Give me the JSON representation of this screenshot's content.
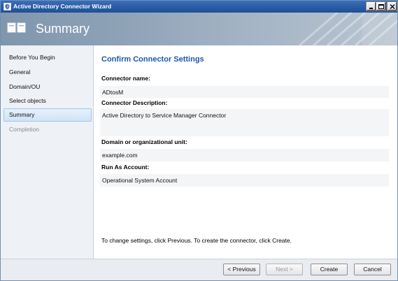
{
  "window": {
    "title": "Active Directory Connector Wizard",
    "app_icon": "shield-icon",
    "controls": [
      "minimize-icon",
      "maximize-icon",
      "close-icon"
    ]
  },
  "header": {
    "title": "Summary",
    "icon": "wizard-pages-icon"
  },
  "sidebar": {
    "items": [
      {
        "label": "Before You Begin",
        "state": "normal"
      },
      {
        "label": "General",
        "state": "normal"
      },
      {
        "label": "Domain/OU",
        "state": "normal"
      },
      {
        "label": "Select objects",
        "state": "normal"
      },
      {
        "label": "Summary",
        "state": "active"
      },
      {
        "label": "Completion",
        "state": "disabled"
      }
    ]
  },
  "main": {
    "section_title": "Confirm Connector Settings",
    "fields": [
      {
        "label": "Connector name:",
        "value": "ADtosM"
      },
      {
        "label": "Connector Description:",
        "value": "Active Directory to Service Manager Connector"
      },
      {
        "label": "Domain or organizational unit:",
        "value": "example.com"
      },
      {
        "label": "Run As Account:",
        "value": "Operational System Account"
      }
    ],
    "hint": "To change settings, click Previous. To create the connector, click Create."
  },
  "footer": {
    "previous_label": "< Previous",
    "next_label": "Next >",
    "create_label": "Create",
    "cancel_label": "Cancel"
  },
  "colors": {
    "title_bar": "#2b5ea8",
    "section_title": "#1d5aa8",
    "selection": "#cfe3f6"
  }
}
